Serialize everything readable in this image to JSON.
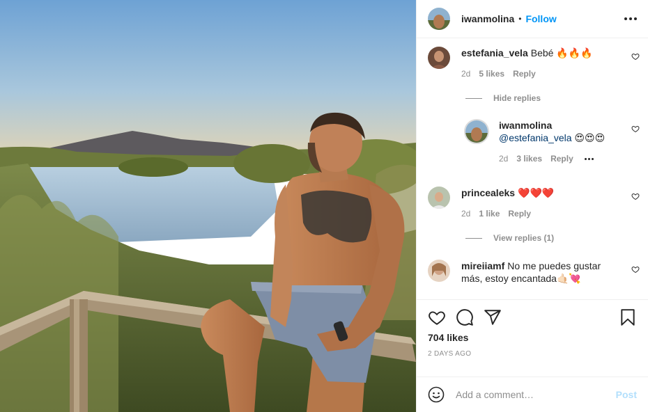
{
  "header": {
    "username": "iwanmolina",
    "separator": "•",
    "follow_label": "Follow",
    "more_icon": "more-horizontal-icon"
  },
  "comments": [
    {
      "username": "estefania_vela",
      "text": "Bebé 🔥🔥🔥",
      "time": "2d",
      "likes": "5 likes",
      "reply": "Reply",
      "toggle": "Hide replies"
    },
    {
      "username": "iwanmolina",
      "mention": "@estefania_vela",
      "text": " 😍😍😍",
      "time": "2d",
      "likes": "3 likes",
      "reply": "Reply"
    },
    {
      "username": "princealeks",
      "text": "❤️❤️❤️",
      "time": "2d",
      "likes": "1 like",
      "reply": "Reply",
      "toggle": "View replies (1)"
    },
    {
      "username": "mireiiamf",
      "text": "No me puedes gustar más, estoy encantada🤙🏻💘"
    }
  ],
  "actions": {
    "like_icon": "heart-icon",
    "comment_icon": "comment-icon",
    "share_icon": "paper-plane-icon",
    "save_icon": "bookmark-icon"
  },
  "likes_count": "704 likes",
  "date": "2 DAYS AGO",
  "add_comment": {
    "placeholder": "Add a comment…",
    "post_label": "Post",
    "emoji_icon": "smiley-icon"
  },
  "colors": {
    "accent": "#0095f6",
    "post_disabled": "#b2dffc",
    "muted": "#8e8e8e",
    "heart_red": "#e0245e"
  }
}
